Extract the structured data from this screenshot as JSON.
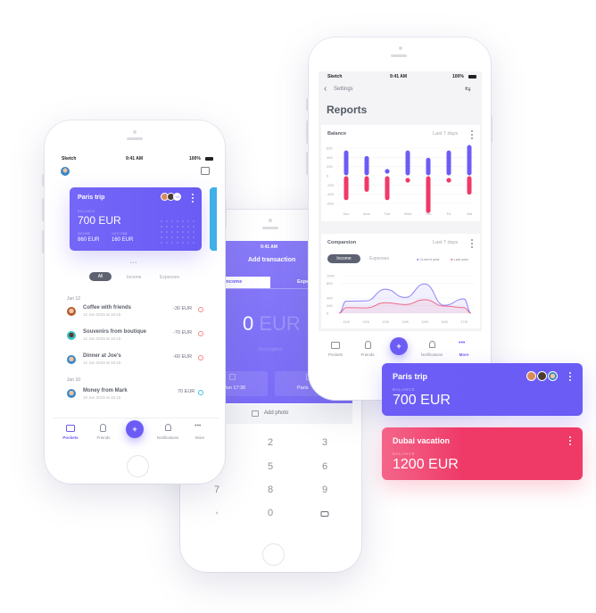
{
  "colors": {
    "accent": "#6c5cf6",
    "expense": "#ef3a68",
    "income_icon": "#3fc1e8",
    "expense_icon": "#f58a8a",
    "dark_pill": "#5d6271",
    "next_card": "#3fb0e8"
  },
  "pockets_screen": {
    "status": {
      "carrier": "Sketch",
      "time": "9:41 AM",
      "battery": "100%"
    },
    "card": {
      "title": "Paris trip",
      "extra_members": "+2",
      "balance_label": "BALANCE",
      "balance": "700 EUR",
      "income_label": "INCOME",
      "income": "860 EUR",
      "outcome_label": "OUTCOME",
      "outcome": "160 EUR"
    },
    "tabs": [
      {
        "label": "All",
        "active": true
      },
      {
        "label": "Income"
      },
      {
        "label": "Expenses"
      }
    ],
    "groups": [
      {
        "date": "Jun 12",
        "items": [
          {
            "title": "Coffee with friends",
            "subtitle": "12 Jun 2019 at 16:15",
            "amount": "-30 EUR",
            "type": "expense"
          },
          {
            "title": "Souvenirs from boutique",
            "subtitle": "12 Jun 2019 at 16:15",
            "amount": "-70 EUR",
            "type": "expense"
          },
          {
            "title": "Dinner at Joe's",
            "subtitle": "12 Jun 2019 at 16:15",
            "amount": "-60 EUR",
            "type": "expense"
          }
        ]
      },
      {
        "date": "Jun 10",
        "items": [
          {
            "title": "Money from Mark",
            "subtitle": "10 Jun 2019 at 16:15",
            "amount": "70 EUR",
            "type": "income"
          }
        ]
      }
    ],
    "nav": [
      {
        "label": "Pockets",
        "icon": "folder-icon",
        "active": true
      },
      {
        "label": "Friends",
        "icon": "person-icon"
      },
      {
        "label": "+",
        "icon": "plus-icon"
      },
      {
        "label": "Notifications",
        "icon": "bell-icon"
      },
      {
        "label": "More",
        "icon": "more-icon"
      }
    ]
  },
  "add_transaction_screen": {
    "time": "9:41 AM",
    "title": "Add transaction",
    "tabs": [
      {
        "label": "Income",
        "active": true
      },
      {
        "label": "Expe"
      }
    ],
    "amount": "0",
    "currency": "EUR",
    "description_placeholder": "Description",
    "date_value": "Jun  17:30",
    "pocket_value": "Paris",
    "add_photo": "Add photo",
    "keypad": [
      "2",
      "3",
      "5",
      "6",
      "7",
      "8",
      "9",
      ",",
      "0"
    ]
  },
  "reports_screen": {
    "status": {
      "carrier": "Sketch",
      "time": "9:41 AM",
      "battery": "100%"
    },
    "back_label": "Settings",
    "title": "Reports",
    "balance": {
      "title": "Balance",
      "period": "Last 7 days"
    },
    "comparison": {
      "title": "Comparsion",
      "period": "Last 7 days",
      "tabs": [
        {
          "label": "Income",
          "active": true
        },
        {
          "label": "Expenses"
        }
      ],
      "legend": [
        "Current year",
        "Last year"
      ]
    },
    "nav": [
      {
        "label": "Pockets"
      },
      {
        "label": "Friends"
      },
      {
        "label": "+"
      },
      {
        "label": "Notifications"
      },
      {
        "label": "More",
        "active": true
      }
    ]
  },
  "pocket_cards": [
    {
      "title": "Paris trip",
      "balance_label": "BALANCE",
      "balance": "700 EUR",
      "color": "#6c5cf6"
    },
    {
      "title": "Dubai vacation",
      "balance_label": "BALANCE",
      "balance": "1200 EUR",
      "color": "#ef3a68"
    }
  ],
  "chart_data": [
    {
      "type": "bar",
      "title": "Balance",
      "categories": [
        "Sun",
        "Mon",
        "Tue",
        "Wed",
        "Thu",
        "Fri",
        "Sat"
      ],
      "series": [
        {
          "values": [
            500,
            380,
            80,
            500,
            340,
            500,
            620
          ],
          "color": "#6c5cf6"
        },
        {
          "values": [
            -480,
            -300,
            -480,
            -160,
            -760,
            -80,
            -360
          ],
          "color": "#ef3a68"
        }
      ],
      "yticks": [
        600,
        400,
        200,
        0,
        -200,
        -400,
        -600
      ],
      "ylim": [
        -600,
        600
      ],
      "grid": true
    },
    {
      "type": "area",
      "title": "Comparsion",
      "categories": [
        "11/6",
        "12/6",
        "13/6",
        "14/6",
        "15/6",
        "16/6",
        "17/6"
      ],
      "series": [
        {
          "name": "Current year",
          "values": [
            320,
            330,
            640,
            420,
            780,
            210,
            380
          ],
          "color": "#8f84f8"
        },
        {
          "name": "Last year",
          "values": [
            150,
            140,
            280,
            230,
            360,
            190,
            150
          ],
          "color": "#f06a8a"
        }
      ],
      "yticks": [
        1000,
        800,
        400,
        200,
        0
      ],
      "ylim": [
        0,
        1000
      ],
      "grid": true,
      "legend": "top-right"
    }
  ]
}
